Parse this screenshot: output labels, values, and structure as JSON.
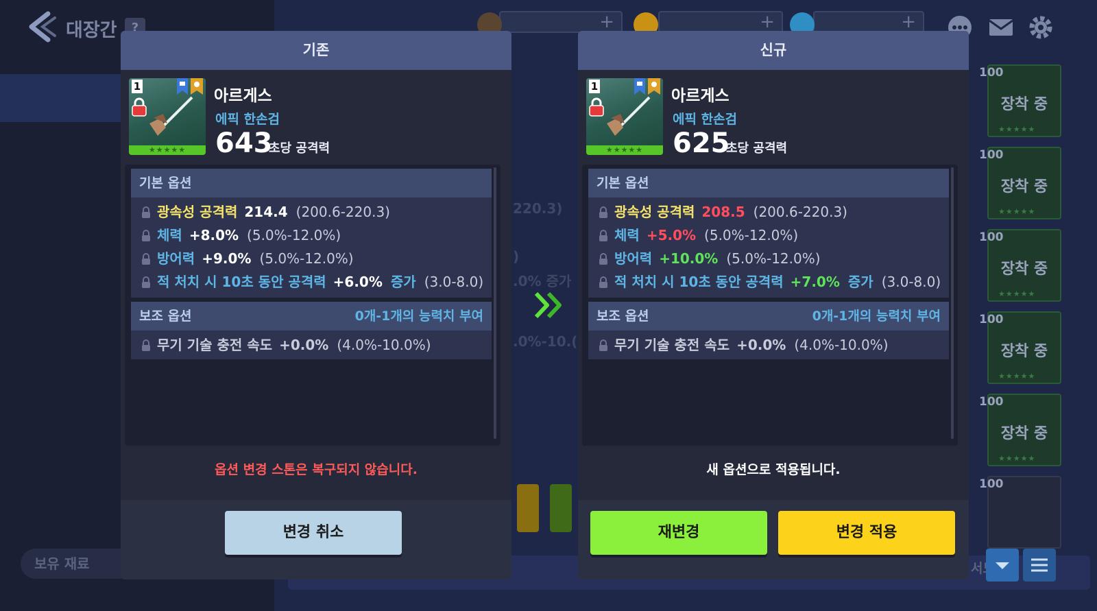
{
  "background": {
    "title": "대장간",
    "help": "?",
    "slots": [
      {
        "count": "100",
        "label": "장착 중"
      },
      {
        "count": "100",
        "label": "장착 중"
      },
      {
        "count": "100",
        "label": "장착 중"
      },
      {
        "count": "100",
        "label": "장착 중"
      },
      {
        "count": "100",
        "label": "장착 중"
      },
      {
        "count": "100",
        "label": ""
      }
    ],
    "stars": "★★★★★",
    "bottom_label": "보유 재료",
    "sort_label": "서도",
    "ghost_range": "220.3)",
    "ghost_frag1": ")",
    "ghost_frag2": ".0% 증가",
    "ghost_frag3": ".0%-10.("
  },
  "currency": [
    {
      "name": "coffee",
      "color": "#4a3a2a"
    },
    {
      "name": "gold",
      "color": "#d9a21e"
    },
    {
      "name": "gem",
      "color": "#3aa2d8"
    }
  ],
  "left_panel": {
    "header": "기존",
    "item": {
      "rank": "1",
      "name": "아르게스",
      "type": "에픽 한손검",
      "dps": "643",
      "dps_label": "초당 공격력",
      "stars": "★★★★★"
    },
    "basic_options_header": "기본 옵션",
    "basic_options": [
      {
        "name": "광속성 공격력",
        "name_color": "#f5e36b",
        "value": "214.4",
        "value_color": "#ffffff",
        "range": "(200.6-220.3)"
      },
      {
        "name": "체력",
        "name_color": "#5fb6e6",
        "value": "+8.0%",
        "value_color": "#ffffff",
        "range": "(5.0%-12.0%)"
      },
      {
        "name": "방어력",
        "name_color": "#5fb6e6",
        "value": "+9.0%",
        "value_color": "#ffffff",
        "range": "(5.0%-12.0%)"
      },
      {
        "name": "적 처치 시 10초 동안 공격력",
        "name_color": "#5fb6e6",
        "value": "+6.0%",
        "value_color": "#ffffff",
        "suffix": "증가",
        "range": "(3.0-8.0)"
      }
    ],
    "sub_options_header": "보조 옵션",
    "sub_options_note": "0개-1개의 능력치 부여",
    "sub_options": [
      {
        "name": "무기 기술 충전 속도",
        "value": "+0.0%",
        "range": "(4.0%-10.0%)"
      }
    ],
    "footer_message": "옵션 변경 스톤은 복구되지 않습니다.",
    "footer_color": "#ff5a5a",
    "cancel_button": "변경 취소"
  },
  "right_panel": {
    "header": "신규",
    "item": {
      "rank": "1",
      "name": "아르게스",
      "type": "에픽 한손검",
      "dps": "625",
      "dps_label": "초당 공격력",
      "stars": "★★★★★"
    },
    "basic_options_header": "기본 옵션",
    "basic_options": [
      {
        "name": "광속성 공격력",
        "name_color": "#f5e36b",
        "value": "208.5",
        "value_color": "#ff4d5e",
        "range": "(200.6-220.3)"
      },
      {
        "name": "체력",
        "name_color": "#5fb6e6",
        "value": "+5.0%",
        "value_color": "#ff4d5e",
        "range": "(5.0%-12.0%)"
      },
      {
        "name": "방어력",
        "name_color": "#5fb6e6",
        "value": "+10.0%",
        "value_color": "#5fe35a",
        "range": "(5.0%-12.0%)"
      },
      {
        "name": "적 처치 시 10초 동안 공격력",
        "name_color": "#5fb6e6",
        "value": "+7.0%",
        "value_color": "#5fe35a",
        "suffix": "증가",
        "range": "(3.0-8.0)"
      }
    ],
    "sub_options_header": "보조 옵션",
    "sub_options_note": "0개-1개의 능력치 부여",
    "sub_options": [
      {
        "name": "무기 기술 충전 속도",
        "value": "+0.0%",
        "range": "(4.0%-10.0%)"
      }
    ],
    "footer_message": "새 옵션으로 적용됩니다.",
    "footer_color": "#ffffff",
    "reroll_button": "재변경",
    "apply_button": "변경 적용"
  },
  "colors": {
    "cancel_btn": "#b9d3e6",
    "reroll_btn": "#8af03c",
    "apply_btn": "#fcd21a",
    "arrow": "#5fe33a"
  }
}
